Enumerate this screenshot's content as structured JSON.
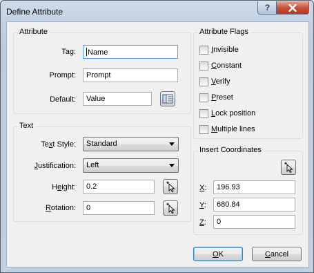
{
  "window": {
    "title": "Define Attribute",
    "help_label": "?",
    "close_label": "x"
  },
  "attribute": {
    "group_title": "Attribute",
    "tag_label": "Tag:",
    "tag_value": "Name",
    "prompt_label": "Prompt:",
    "prompt_value": "Prompt",
    "default_label": "Default:",
    "default_value": "Value"
  },
  "flags": {
    "group_title": "Attribute Flags",
    "items": [
      {
        "key": "I",
        "rest": "nvisible",
        "checked": false
      },
      {
        "key": "C",
        "rest": "onstant",
        "checked": false
      },
      {
        "key": "V",
        "rest": "erify",
        "checked": false
      },
      {
        "key": "P",
        "rest": "reset",
        "checked": false
      },
      {
        "key": "L",
        "rest": "ock position",
        "checked": false
      },
      {
        "key": "M",
        "rest": "ultiple lines",
        "checked": false
      }
    ]
  },
  "text": {
    "group_title": "Text",
    "style_label_pre": "Te",
    "style_label_key": "x",
    "style_label_post": "t Style:",
    "style_value": "Standard",
    "just_label_key": "J",
    "just_label_post": "ustification:",
    "just_value": "Left",
    "height_label_pre": "H",
    "height_label_key": "e",
    "height_label_post": "ight:",
    "height_value": "0.2",
    "rotation_label_key": "R",
    "rotation_label_post": "otation:",
    "rotation_value": "0"
  },
  "insert": {
    "group_title": "Insert Coordinates",
    "x_key": "X",
    "x_value": "196.93",
    "y_key": "Y",
    "y_value": "680.84",
    "z_key": "Z",
    "z_value": "0"
  },
  "buttons": {
    "ok_key": "O",
    "ok_rest": "K",
    "cancel_key": "C",
    "cancel_rest": "ancel"
  }
}
